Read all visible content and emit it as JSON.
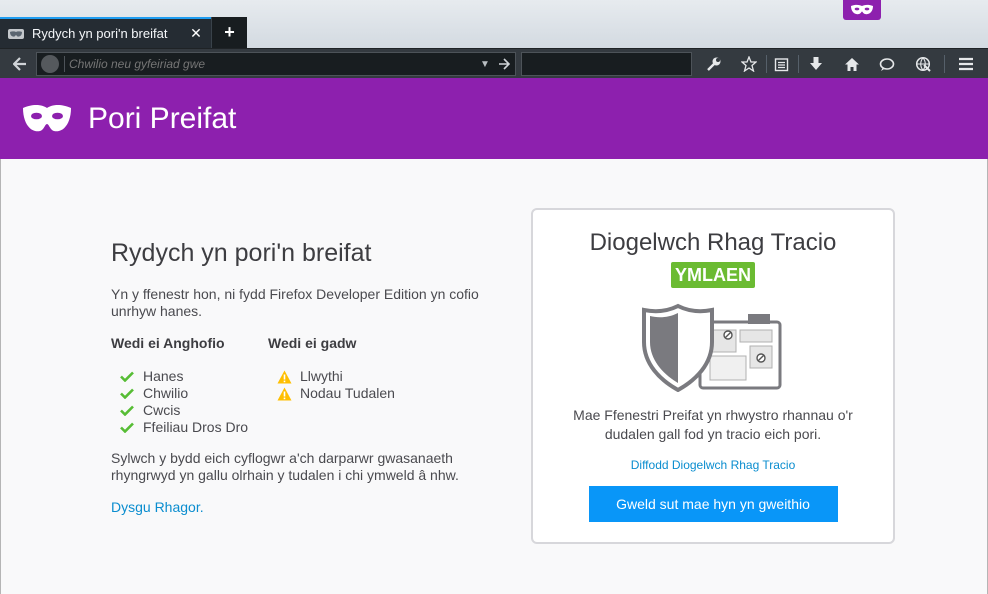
{
  "tab": {
    "title": "Rydych yn pori'n breifat",
    "close_glyph": "✕",
    "new_glyph": "+"
  },
  "navbar": {
    "url_placeholder": "Chwilio neu gyfeiriad gwe",
    "icons": [
      "back-icon",
      "identity-icon",
      "dropmarker-icon",
      "go-icon",
      "search-icon",
      "developer-icon",
      "bookmark-star-icon",
      "reading-list-icon",
      "downloads-icon",
      "home-icon",
      "chat-icon",
      "web-ide-icon",
      "menu-icon"
    ]
  },
  "header": {
    "title": "Pori Preifat"
  },
  "left": {
    "title": "Rydych yn pori'n breifat",
    "intro": "Yn y ffenestr hon, ni fydd Firefox Developer Edition yn cofio unrhyw hanes.",
    "forgotten_heading": "Wedi ei Anghofio",
    "forgotten_items": [
      "Hanes",
      "Chwilio",
      "Cwcis",
      "Ffeiliau Dros Dro"
    ],
    "kept_heading": "Wedi ei gadw",
    "kept_items": [
      "Llwythi",
      "Nodau Tudalen"
    ],
    "note": "Sylwch y bydd eich cyflogwr a'ch darparwr gwasanaeth rhyngrwyd yn gallu olrhain y tudalen i chi ymweld â nhw.",
    "learn_more": "Dysgu Rhagor."
  },
  "card": {
    "title": "Diogelwch Rhag Tracio",
    "status": "YMLAEN",
    "description": "Mae Ffenestri Preifat yn rhwystro rhannau o'r dudalen gall fod yn tracio eich pori.",
    "turn_off": "Diffodd Diogelwch Rhag Tracio",
    "how_button": "Gweld sut mae hyn yn gweithio"
  },
  "colors": {
    "accent": "#8d20ae",
    "link": "#0a8dcf",
    "button": "#0996f8",
    "check": "#57bd35",
    "warn": "#ffbf00"
  }
}
